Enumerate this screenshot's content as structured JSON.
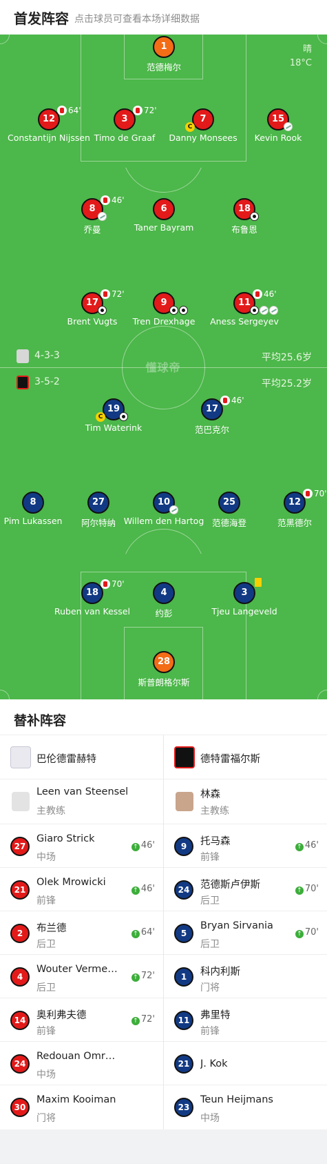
{
  "header": {
    "title": "首发阵容",
    "subtitle": "点击球员可查看本场详细数据"
  },
  "weather": {
    "condition": "晴",
    "temp": "18°C"
  },
  "watermark": "懂球帝",
  "home": {
    "formation": "4-3-3",
    "avg_age": "平均25.6岁"
  },
  "away": {
    "formation": "3-5-2",
    "avg_age": "平均25.2岁"
  },
  "players": [
    {
      "num": "1",
      "name": "范德梅尔",
      "color": "orange"
    },
    {
      "num": "12",
      "name": "Constantijn Nijssen",
      "color": "red",
      "sub": "64'"
    },
    {
      "num": "3",
      "name": "Timo de Graaf",
      "color": "red",
      "sub": "72'"
    },
    {
      "num": "7",
      "name": "Danny Monsees",
      "color": "red",
      "captain": "C"
    },
    {
      "num": "15",
      "name": "Kevin Rook",
      "color": "red"
    },
    {
      "num": "8",
      "name": "乔曼",
      "color": "red",
      "sub": "46'"
    },
    {
      "num": "6",
      "name": "Taner Bayram",
      "color": "red"
    },
    {
      "num": "18",
      "name": "布鲁恩",
      "color": "red"
    },
    {
      "num": "17",
      "name": "Brent Vugts",
      "color": "red",
      "sub": "72'"
    },
    {
      "num": "9",
      "name": "Tren Drexhage",
      "color": "red"
    },
    {
      "num": "11",
      "name": "Aness Sergeyev",
      "color": "red",
      "sub": "46'"
    },
    {
      "num": "19",
      "name": "Tim Waterink",
      "color": "blue",
      "captain": "C"
    },
    {
      "num": "17",
      "name": "范巴克尔",
      "color": "blue",
      "sub": "46'"
    },
    {
      "num": "8",
      "name": "Pim Lukassen",
      "color": "blue"
    },
    {
      "num": "27",
      "name": "阿尔特纳",
      "color": "blue"
    },
    {
      "num": "10",
      "name": "Willem den Hartog",
      "color": "blue"
    },
    {
      "num": "25",
      "name": "范德海登",
      "color": "blue"
    },
    {
      "num": "12",
      "name": "范黑德尔",
      "color": "blue",
      "sub": "70'"
    },
    {
      "num": "18",
      "name": "Ruben van Kessel",
      "color": "blue",
      "sub": "70'"
    },
    {
      "num": "4",
      "name": "约彭",
      "color": "blue"
    },
    {
      "num": "3",
      "name": "Tjeu Langeveld",
      "color": "blue"
    },
    {
      "num": "28",
      "name": "斯普朗格尔斯",
      "color": "orange"
    }
  ],
  "subs_title": "替补阵容",
  "subs_home": {
    "team": "巴伦德雷赫特",
    "coach": {
      "name": "Leen van Steensel",
      "role": "主教练"
    },
    "list": [
      {
        "num": "27",
        "name": "Giaro Strick",
        "pos": "中场",
        "in": "46'"
      },
      {
        "num": "21",
        "name": "Olek Mrowicki",
        "pos": "前锋",
        "in": "46'"
      },
      {
        "num": "2",
        "name": "布兰德",
        "pos": "后卫",
        "in": "64'"
      },
      {
        "num": "4",
        "name": "Wouter Vermeulen",
        "pos": "后卫",
        "in": "72'"
      },
      {
        "num": "14",
        "name": "奥利弗夫德",
        "pos": "前锋",
        "in": "72'"
      },
      {
        "num": "24",
        "name": "Redouan Omrani",
        "pos": "中场",
        "in": ""
      },
      {
        "num": "30",
        "name": "Maxim Kooiman",
        "pos": "门将",
        "in": ""
      }
    ]
  },
  "subs_away": {
    "team": "德特雷福尔斯",
    "coach": {
      "name": "林森",
      "role": "主教练"
    },
    "list": [
      {
        "num": "9",
        "name": "托马森",
        "pos": "前锋",
        "in": "46'"
      },
      {
        "num": "24",
        "name": "范德斯卢伊斯",
        "pos": "后卫",
        "in": "70'"
      },
      {
        "num": "5",
        "name": "Bryan Sirvania",
        "pos": "后卫",
        "in": "70'"
      },
      {
        "num": "1",
        "name": "科内利斯",
        "pos": "门将",
        "in": ""
      },
      {
        "num": "11",
        "name": "弗里特",
        "pos": "前锋",
        "in": ""
      },
      {
        "num": "21",
        "name": "J. Kok",
        "pos": "",
        "in": ""
      },
      {
        "num": "23",
        "name": "Teun Heijmans",
        "pos": "中场",
        "in": ""
      }
    ]
  }
}
